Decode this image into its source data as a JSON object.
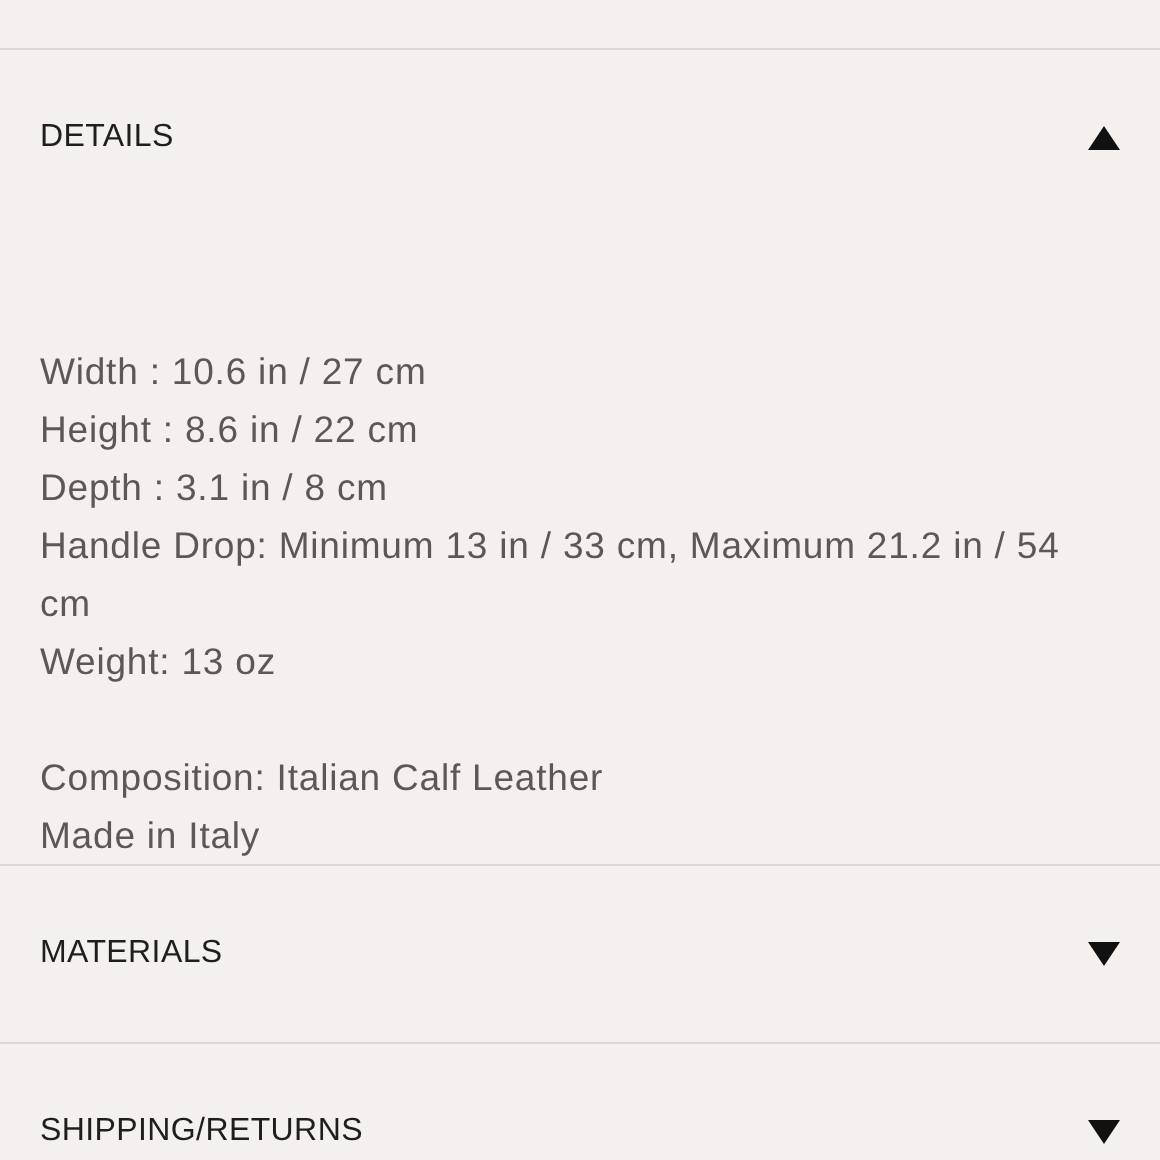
{
  "sections": [
    {
      "title": "DETAILS",
      "expanded": true,
      "paragraphs": [
        [
          "Width : 10.6 in / 27 cm",
          "Height : 8.6 in / 22 cm",
          "Depth : 3.1 in / 8 cm",
          "Handle Drop: Minimum 13 in / 33 cm, Maximum 21.2 in / 54 cm",
          "Weight: 13 oz"
        ],
        [
          "Composition: Italian Calf Leather",
          "Made in Italy"
        ]
      ]
    },
    {
      "title": "MATERIALS",
      "expanded": false
    },
    {
      "title": "SHIPPING/RETURNS",
      "expanded": false
    }
  ]
}
